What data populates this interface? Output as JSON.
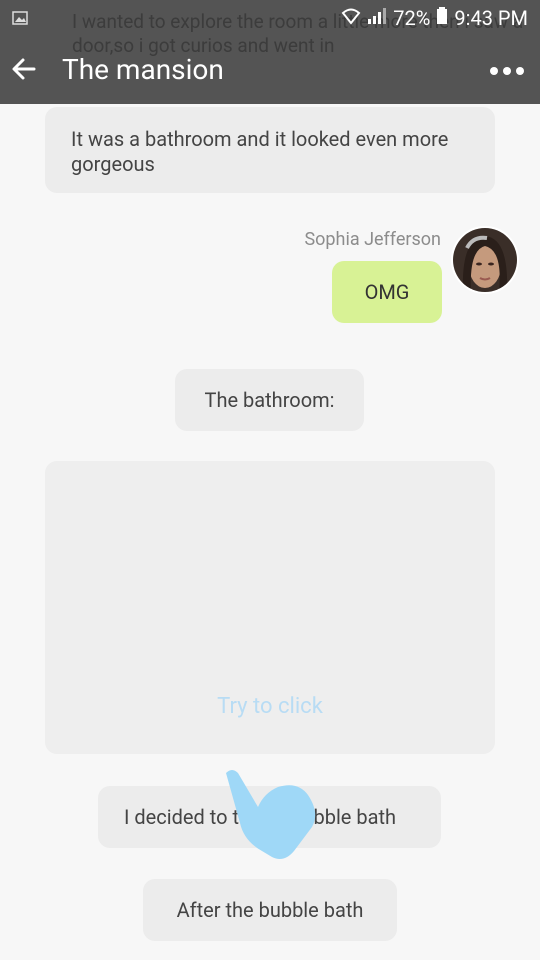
{
  "status": {
    "battery": "72%",
    "time": "9:43 PM"
  },
  "header": {
    "title": "The mansion",
    "scroll_text": "I wanted to explore the room a little more then i saw a door,so i got curios and went in"
  },
  "messages": [
    {
      "text": "It was a bathroom and it looked even more gorgeous"
    },
    {
      "sender": "Sophia Jefferson",
      "text": "OMG"
    },
    {
      "text": "The bathroom:"
    },
    {
      "text": "I decided to take a bubble bath"
    },
    {
      "text": "After the bubble bath"
    }
  ],
  "image_placeholder": {
    "hint": "Try to click"
  },
  "colors": {
    "topbar": "#4d4d4d",
    "bubble": "#ececec",
    "own_bubble": "#d8f295",
    "hint": "#b8dcf4",
    "hand": "#9fd8f7"
  }
}
